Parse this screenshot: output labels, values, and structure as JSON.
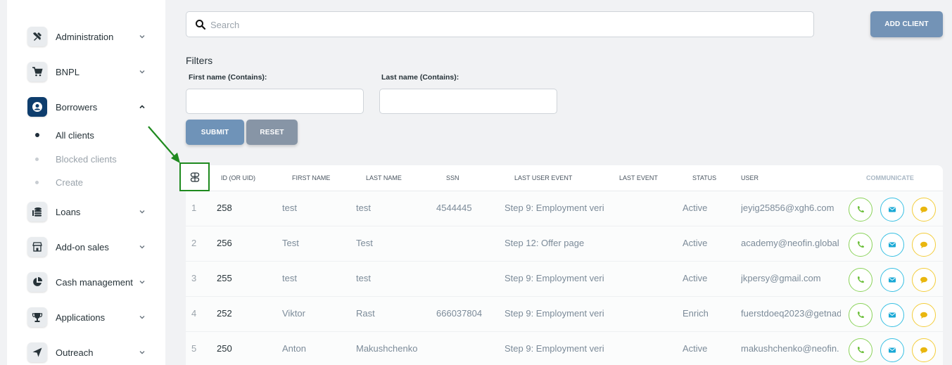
{
  "colors": {
    "nav_active": "#0e3d6d",
    "primary_button": "#7393b6",
    "reset_button": "#8795a6",
    "call": "#8bd35b",
    "mail": "#39c0e3",
    "chat": "#f3cd3b",
    "annotation": "#1f8a1f"
  },
  "sidebar": {
    "items": [
      {
        "label": "Administration",
        "icon": "tools-icon",
        "expanded": false
      },
      {
        "label": "BNPL",
        "icon": "cart-icon",
        "expanded": false
      },
      {
        "label": "Borrowers",
        "icon": "user-circle-icon",
        "expanded": true
      },
      {
        "label": "Loans",
        "icon": "coins-icon",
        "expanded": false
      },
      {
        "label": "Add-on sales",
        "icon": "store-icon",
        "expanded": false
      },
      {
        "label": "Cash management",
        "icon": "pie-icon",
        "expanded": false
      },
      {
        "label": "Applications",
        "icon": "trophy-icon",
        "expanded": false
      },
      {
        "label": "Outreach",
        "icon": "send-icon",
        "expanded": false
      }
    ],
    "borrowers_sub": [
      {
        "label": "All clients",
        "active": true
      },
      {
        "label": "Blocked clients",
        "active": false
      },
      {
        "label": "Create",
        "active": false
      }
    ]
  },
  "search": {
    "placeholder": "Search",
    "value": ""
  },
  "add_client_label": "ADD CLIENT",
  "filters": {
    "title": "Filters",
    "first_name_label": "First name (Contains):",
    "last_name_label": "Last name (Contains):",
    "submit_label": "SUBMIT",
    "reset_label": "RESET"
  },
  "table": {
    "columns": [
      "ID (OR UID)",
      "FIRST NAME",
      "LAST NAME",
      "SSN",
      "LAST USER EVENT",
      "LAST EVENT",
      "STATUS",
      "USER",
      "COMMUNICATE"
    ],
    "rows": [
      {
        "idx": "1",
        "id": "258",
        "first": "test",
        "last": "test",
        "ssn": "4544445",
        "user_event": "Step 9: Employment veri",
        "last_event": "",
        "status": "Active",
        "user": "jeyig25856@xgh6.com"
      },
      {
        "idx": "2",
        "id": "256",
        "first": "Test",
        "last": "Test",
        "ssn": "",
        "user_event": "Step 12: Offer page",
        "last_event": "",
        "status": "Active",
        "user": "academy@neofin.global"
      },
      {
        "idx": "3",
        "id": "255",
        "first": "test",
        "last": "test",
        "ssn": "",
        "user_event": "Step 9: Employment veri",
        "last_event": "",
        "status": "Active",
        "user": "jkpersy@gmail.com"
      },
      {
        "idx": "4",
        "id": "252",
        "first": "Viktor",
        "last": "Rast",
        "ssn": "666037804",
        "user_event": "Step 9: Employment veri",
        "last_event": "",
        "status": "Enrich",
        "user": "fuerstdoeq2023@getnad"
      },
      {
        "idx": "5",
        "id": "250",
        "first": "Anton",
        "last": "Makushchenko",
        "ssn": "",
        "user_event": "Step 9: Employment veri",
        "last_event": "",
        "status": "Active",
        "user": "makushchenko@neofin."
      }
    ]
  }
}
